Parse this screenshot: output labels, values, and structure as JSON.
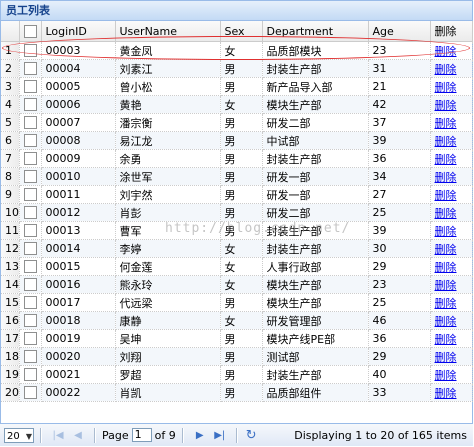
{
  "panel": {
    "title": "员工列表"
  },
  "columns": {
    "loginid": "LoginID",
    "username": "UserName",
    "sex": "Sex",
    "department": "Department",
    "age": "Age",
    "delete": "删除"
  },
  "rows": [
    {
      "n": "1",
      "id": "00003",
      "name": "黄金凤",
      "sex": "女",
      "dept": "品质部模块",
      "age": "23",
      "del": "删除"
    },
    {
      "n": "2",
      "id": "00004",
      "name": "刘素江",
      "sex": "男",
      "dept": "封装生产部",
      "age": "31",
      "del": "删除"
    },
    {
      "n": "3",
      "id": "00005",
      "name": "曾小松",
      "sex": "男",
      "dept": "新产品导入部",
      "age": "21",
      "del": "删除"
    },
    {
      "n": "4",
      "id": "00006",
      "name": "黄艳",
      "sex": "女",
      "dept": "模块生产部",
      "age": "42",
      "del": "删除"
    },
    {
      "n": "5",
      "id": "00007",
      "name": "潘宗衡",
      "sex": "男",
      "dept": "研发二部",
      "age": "37",
      "del": "删除"
    },
    {
      "n": "6",
      "id": "00008",
      "name": "易江龙",
      "sex": "男",
      "dept": "中试部",
      "age": "39",
      "del": "删除"
    },
    {
      "n": "7",
      "id": "00009",
      "name": "余勇",
      "sex": "男",
      "dept": "封装生产部",
      "age": "36",
      "del": "删除"
    },
    {
      "n": "8",
      "id": "00010",
      "name": "涂世军",
      "sex": "男",
      "dept": "研发一部",
      "age": "34",
      "del": "删除"
    },
    {
      "n": "9",
      "id": "00011",
      "name": "刘宇然",
      "sex": "男",
      "dept": "研发一部",
      "age": "27",
      "del": "删除"
    },
    {
      "n": "10",
      "id": "00012",
      "name": "肖彭",
      "sex": "男",
      "dept": "研发二部",
      "age": "25",
      "del": "删除"
    },
    {
      "n": "11",
      "id": "00013",
      "name": "曹军",
      "sex": "男",
      "dept": "封装生产部",
      "age": "39",
      "del": "删除"
    },
    {
      "n": "12",
      "id": "00014",
      "name": "李婷",
      "sex": "女",
      "dept": "封装生产部",
      "age": "30",
      "del": "删除"
    },
    {
      "n": "13",
      "id": "00015",
      "name": "何金莲",
      "sex": "女",
      "dept": "人事行政部",
      "age": "29",
      "del": "删除"
    },
    {
      "n": "14",
      "id": "00016",
      "name": "熊永玲",
      "sex": "女",
      "dept": "模块生产部",
      "age": "23",
      "del": "删除"
    },
    {
      "n": "15",
      "id": "00017",
      "name": "代远梁",
      "sex": "男",
      "dept": "模块生产部",
      "age": "25",
      "del": "删除"
    },
    {
      "n": "16",
      "id": "00018",
      "name": "康静",
      "sex": "女",
      "dept": "研发管理部",
      "age": "46",
      "del": "删除"
    },
    {
      "n": "17",
      "id": "00019",
      "name": "吴坤",
      "sex": "男",
      "dept": "模块产线PE部",
      "age": "36",
      "del": "删除"
    },
    {
      "n": "18",
      "id": "00020",
      "name": "刘翔",
      "sex": "男",
      "dept": "测试部",
      "age": "29",
      "del": "删除"
    },
    {
      "n": "19",
      "id": "00021",
      "name": "罗超",
      "sex": "男",
      "dept": "封装生产部",
      "age": "40",
      "del": "删除"
    },
    {
      "n": "20",
      "id": "00022",
      "name": "肖凯",
      "sex": "男",
      "dept": "品质部组件",
      "age": "33",
      "del": "删除"
    }
  ],
  "watermark": "http://blog.csdn.net/",
  "pager": {
    "page_size": "20",
    "page_label": "Page",
    "current_page": "1",
    "of_label": "of 9",
    "display": "Displaying 1 to 20 of 165 items"
  }
}
